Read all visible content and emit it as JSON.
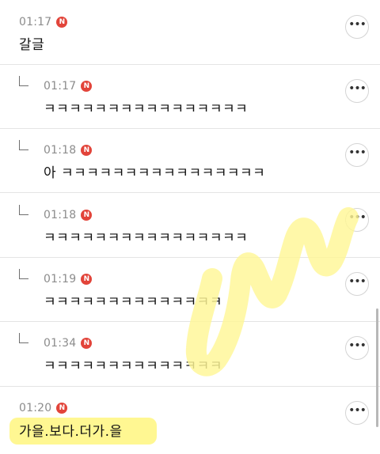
{
  "comments": [
    {
      "time": "01:17",
      "badge": "N",
      "text": "갈글",
      "more": "•••"
    },
    {
      "time": "01:17",
      "badge": "N",
      "text": "ㅋㅋㅋㅋㅋㅋㅋㅋㅋㅋㅋㅋㅋㅋㅋㅋ",
      "more": "•••"
    },
    {
      "time": "01:18",
      "badge": "N",
      "text": "아 ㅋㅋㅋㅋㅋㅋㅋㅋㅋㅋㅋㅋㅋㅋㅋㅋ",
      "more": "•••"
    },
    {
      "time": "01:18",
      "badge": "N",
      "text": "ㅋㅋㅋㅋㅋㅋㅋㅋㅋㅋㅋㅋㅋㅋㅋㅋ",
      "more": "•••"
    },
    {
      "time": "01:19",
      "badge": "N",
      "text": "ㅋㅋㅋㅋㅋㅋㅋㅋㅋㅋㅋㅋㅋㅋ",
      "more": "•••"
    },
    {
      "time": "01:34",
      "badge": "N",
      "text": "ㅋㅋㅋㅋㅋㅋㅋㅋㅋㅋㅋㅋㅋㅋ",
      "more": "•••"
    },
    {
      "time": "01:20",
      "badge": "N",
      "text": "가을.보다.더가.을",
      "more": "•••"
    }
  ],
  "colors": {
    "badge": "#e2443a",
    "highlight": "#fff46e",
    "scribble": "#fff59a"
  }
}
